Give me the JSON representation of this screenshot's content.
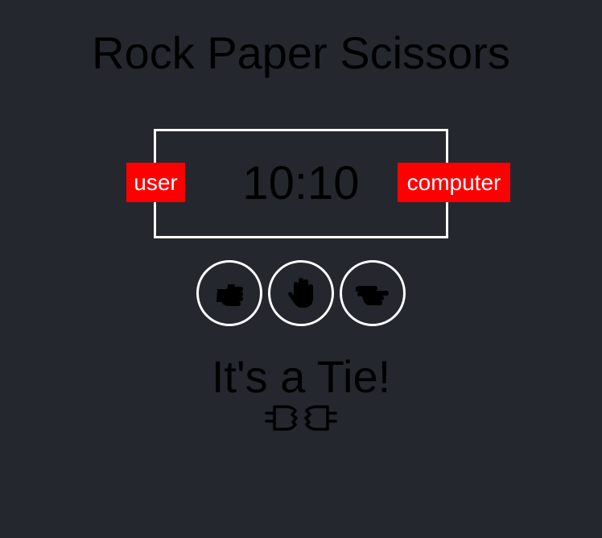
{
  "title": "Rock Paper Scissors",
  "scoreboard": {
    "user_label": "user",
    "computer_label": "computer",
    "score": "10:10"
  },
  "choices": [
    {
      "id": "rock",
      "icon": "fist-icon"
    },
    {
      "id": "paper",
      "icon": "raised-hand-icon"
    },
    {
      "id": "scissors",
      "icon": "peace-hand-icon"
    }
  ],
  "result": {
    "message": "It's a Tie!",
    "icon": "broken-link-icon"
  },
  "colors": {
    "background": "#24272e",
    "badge": "#ff0000",
    "border": "#ffffff"
  }
}
